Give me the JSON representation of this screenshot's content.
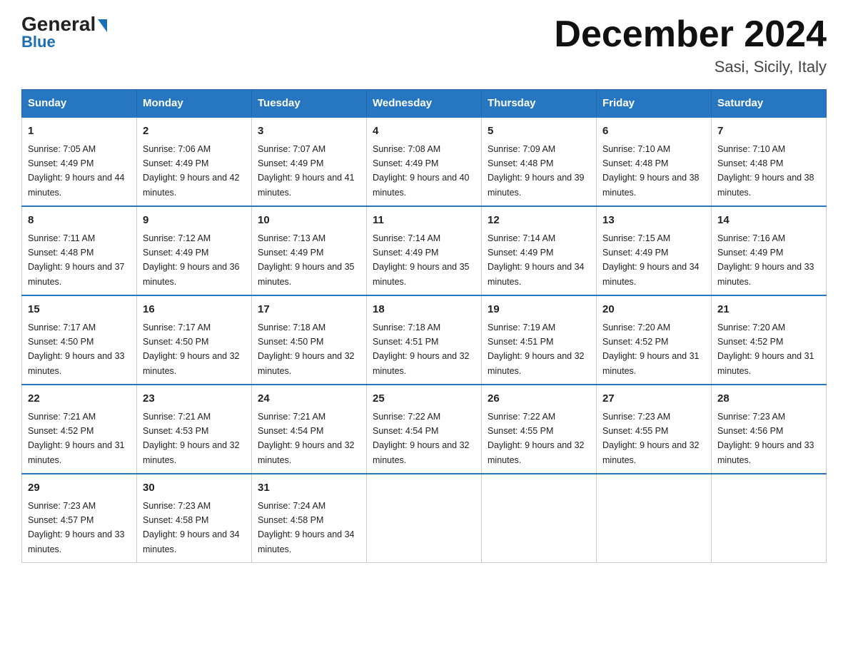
{
  "header": {
    "logo_general": "General",
    "logo_blue": "Blue",
    "month_title": "December 2024",
    "location": "Sasi, Sicily, Italy"
  },
  "days_of_week": [
    "Sunday",
    "Monday",
    "Tuesday",
    "Wednesday",
    "Thursday",
    "Friday",
    "Saturday"
  ],
  "weeks": [
    [
      {
        "day": "1",
        "sunrise": "7:05 AM",
        "sunset": "4:49 PM",
        "daylight": "9 hours and 44 minutes."
      },
      {
        "day": "2",
        "sunrise": "7:06 AM",
        "sunset": "4:49 PM",
        "daylight": "9 hours and 42 minutes."
      },
      {
        "day": "3",
        "sunrise": "7:07 AM",
        "sunset": "4:49 PM",
        "daylight": "9 hours and 41 minutes."
      },
      {
        "day": "4",
        "sunrise": "7:08 AM",
        "sunset": "4:49 PM",
        "daylight": "9 hours and 40 minutes."
      },
      {
        "day": "5",
        "sunrise": "7:09 AM",
        "sunset": "4:48 PM",
        "daylight": "9 hours and 39 minutes."
      },
      {
        "day": "6",
        "sunrise": "7:10 AM",
        "sunset": "4:48 PM",
        "daylight": "9 hours and 38 minutes."
      },
      {
        "day": "7",
        "sunrise": "7:10 AM",
        "sunset": "4:48 PM",
        "daylight": "9 hours and 38 minutes."
      }
    ],
    [
      {
        "day": "8",
        "sunrise": "7:11 AM",
        "sunset": "4:48 PM",
        "daylight": "9 hours and 37 minutes."
      },
      {
        "day": "9",
        "sunrise": "7:12 AM",
        "sunset": "4:49 PM",
        "daylight": "9 hours and 36 minutes."
      },
      {
        "day": "10",
        "sunrise": "7:13 AM",
        "sunset": "4:49 PM",
        "daylight": "9 hours and 35 minutes."
      },
      {
        "day": "11",
        "sunrise": "7:14 AM",
        "sunset": "4:49 PM",
        "daylight": "9 hours and 35 minutes."
      },
      {
        "day": "12",
        "sunrise": "7:14 AM",
        "sunset": "4:49 PM",
        "daylight": "9 hours and 34 minutes."
      },
      {
        "day": "13",
        "sunrise": "7:15 AM",
        "sunset": "4:49 PM",
        "daylight": "9 hours and 34 minutes."
      },
      {
        "day": "14",
        "sunrise": "7:16 AM",
        "sunset": "4:49 PM",
        "daylight": "9 hours and 33 minutes."
      }
    ],
    [
      {
        "day": "15",
        "sunrise": "7:17 AM",
        "sunset": "4:50 PM",
        "daylight": "9 hours and 33 minutes."
      },
      {
        "day": "16",
        "sunrise": "7:17 AM",
        "sunset": "4:50 PM",
        "daylight": "9 hours and 32 minutes."
      },
      {
        "day": "17",
        "sunrise": "7:18 AM",
        "sunset": "4:50 PM",
        "daylight": "9 hours and 32 minutes."
      },
      {
        "day": "18",
        "sunrise": "7:18 AM",
        "sunset": "4:51 PM",
        "daylight": "9 hours and 32 minutes."
      },
      {
        "day": "19",
        "sunrise": "7:19 AM",
        "sunset": "4:51 PM",
        "daylight": "9 hours and 32 minutes."
      },
      {
        "day": "20",
        "sunrise": "7:20 AM",
        "sunset": "4:52 PM",
        "daylight": "9 hours and 31 minutes."
      },
      {
        "day": "21",
        "sunrise": "7:20 AM",
        "sunset": "4:52 PM",
        "daylight": "9 hours and 31 minutes."
      }
    ],
    [
      {
        "day": "22",
        "sunrise": "7:21 AM",
        "sunset": "4:52 PM",
        "daylight": "9 hours and 31 minutes."
      },
      {
        "day": "23",
        "sunrise": "7:21 AM",
        "sunset": "4:53 PM",
        "daylight": "9 hours and 32 minutes."
      },
      {
        "day": "24",
        "sunrise": "7:21 AM",
        "sunset": "4:54 PM",
        "daylight": "9 hours and 32 minutes."
      },
      {
        "day": "25",
        "sunrise": "7:22 AM",
        "sunset": "4:54 PM",
        "daylight": "9 hours and 32 minutes."
      },
      {
        "day": "26",
        "sunrise": "7:22 AM",
        "sunset": "4:55 PM",
        "daylight": "9 hours and 32 minutes."
      },
      {
        "day": "27",
        "sunrise": "7:23 AM",
        "sunset": "4:55 PM",
        "daylight": "9 hours and 32 minutes."
      },
      {
        "day": "28",
        "sunrise": "7:23 AM",
        "sunset": "4:56 PM",
        "daylight": "9 hours and 33 minutes."
      }
    ],
    [
      {
        "day": "29",
        "sunrise": "7:23 AM",
        "sunset": "4:57 PM",
        "daylight": "9 hours and 33 minutes."
      },
      {
        "day": "30",
        "sunrise": "7:23 AM",
        "sunset": "4:58 PM",
        "daylight": "9 hours and 34 minutes."
      },
      {
        "day": "31",
        "sunrise": "7:24 AM",
        "sunset": "4:58 PM",
        "daylight": "9 hours and 34 minutes."
      },
      null,
      null,
      null,
      null
    ]
  ],
  "labels": {
    "sunrise_prefix": "Sunrise: ",
    "sunset_prefix": "Sunset: ",
    "daylight_prefix": "Daylight: "
  }
}
